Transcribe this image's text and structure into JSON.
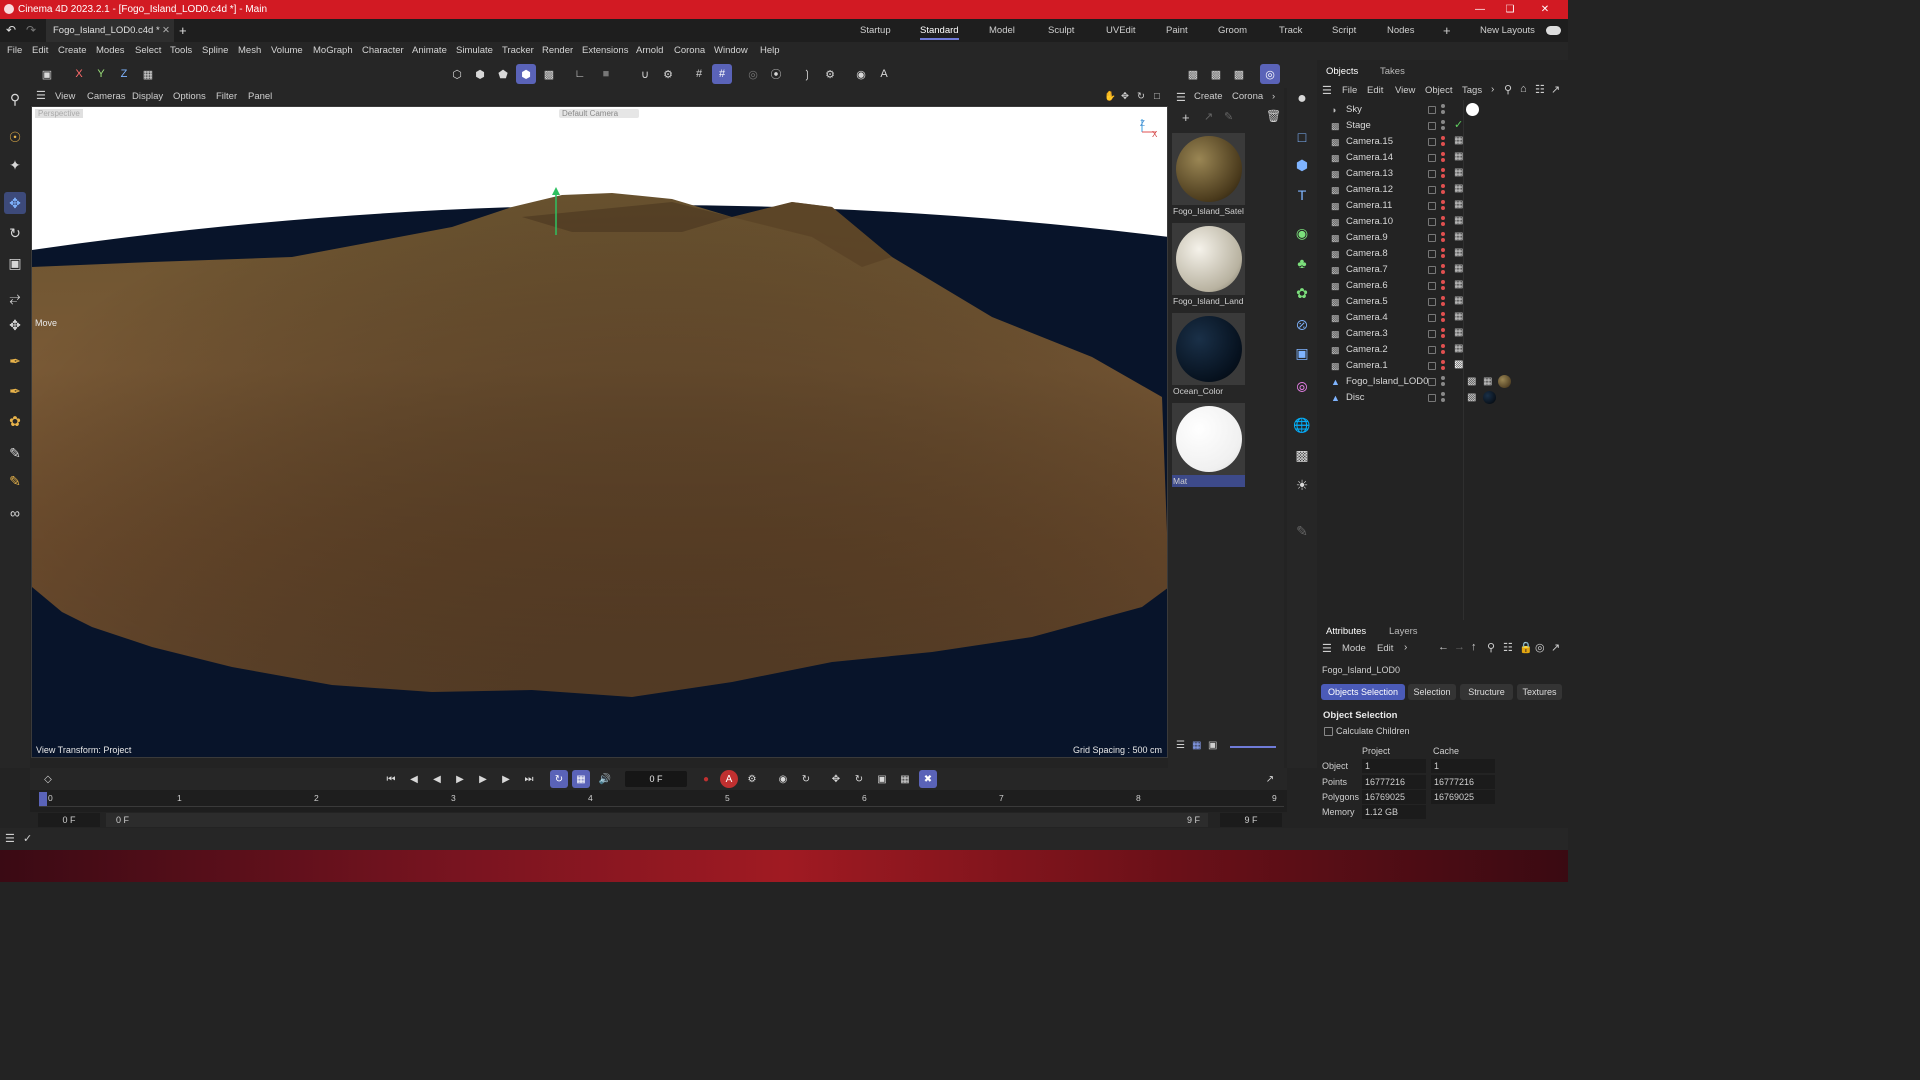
{
  "app_title": "Cinema 4D 2023.2.1 - [Fogo_Island_LOD0.c4d *] - Main",
  "document_tab": "Fogo_Island_LOD0.c4d *",
  "layouts": [
    "Startup",
    "Standard",
    "Model",
    "Sculpt",
    "UVEdit",
    "Paint",
    "Groom",
    "Track",
    "Script",
    "Nodes"
  ],
  "active_layout": "Standard",
  "new_layouts_label": "New Layouts",
  "menu": [
    "File",
    "Edit",
    "Create",
    "Modes",
    "Select",
    "Tools",
    "Spline",
    "Mesh",
    "Volume",
    "MoGraph",
    "Character",
    "Animate",
    "Simulate",
    "Tracker",
    "Render",
    "Extensions",
    "Arnold",
    "Corona",
    "Window",
    "Help"
  ],
  "axis_labels": {
    "x": "X",
    "y": "Y",
    "z": "Z"
  },
  "viewport": {
    "menu": [
      "View",
      "Cameras",
      "Display",
      "Options",
      "Filter",
      "Panel"
    ],
    "view_label": "Perspective",
    "camera_label": "Default Camera",
    "tool_label": "Move",
    "view_transform": "View Transform: Project",
    "grid_spacing": "Grid Spacing : 500 cm"
  },
  "material_manager": {
    "menu": [
      "Create",
      "Corona"
    ],
    "materials": [
      {
        "name": "Fogo_Island_Satel",
        "color": "#6b5a34"
      },
      {
        "name": "Fogo_Island_Land",
        "color": "#c9c3b3"
      },
      {
        "name": "Ocean_Color",
        "color": "#0a1a2e"
      },
      {
        "name": "Mat",
        "color": "#ffffff"
      }
    ]
  },
  "objects_panel": {
    "tabs": [
      "Objects",
      "Takes"
    ],
    "menu": [
      "File",
      "Edit",
      "View",
      "Object",
      "Tags"
    ],
    "objects": [
      {
        "name": "Sky",
        "icon": "sky"
      },
      {
        "name": "Stage",
        "icon": "stage"
      },
      {
        "name": "Camera.15",
        "icon": "camera"
      },
      {
        "name": "Camera.14",
        "icon": "camera"
      },
      {
        "name": "Camera.13",
        "icon": "camera"
      },
      {
        "name": "Camera.12",
        "icon": "camera"
      },
      {
        "name": "Camera.11",
        "icon": "camera"
      },
      {
        "name": "Camera.10",
        "icon": "camera"
      },
      {
        "name": "Camera.9",
        "icon": "camera"
      },
      {
        "name": "Camera.8",
        "icon": "camera"
      },
      {
        "name": "Camera.7",
        "icon": "camera"
      },
      {
        "name": "Camera.6",
        "icon": "camera"
      },
      {
        "name": "Camera.5",
        "icon": "camera"
      },
      {
        "name": "Camera.4",
        "icon": "camera"
      },
      {
        "name": "Camera.3",
        "icon": "camera"
      },
      {
        "name": "Camera.2",
        "icon": "camera"
      },
      {
        "name": "Camera.1",
        "icon": "camera"
      },
      {
        "name": "Fogo_Island_LOD0",
        "icon": "polygon"
      },
      {
        "name": "Disc",
        "icon": "polygon"
      }
    ]
  },
  "attributes_panel": {
    "tabs": [
      "Attributes",
      "Layers"
    ],
    "menu": [
      "Mode",
      "Edit"
    ],
    "object_name": "Fogo_Island_LOD0",
    "buttons": [
      "Objects Selection",
      "Selection",
      "Structure",
      "Textures"
    ],
    "section_title": "Object Selection",
    "calculate_children": "Calculate Children",
    "col_project": "Project",
    "col_cache": "Cache",
    "rows": [
      {
        "label": "Object",
        "project": "1",
        "cache": "1"
      },
      {
        "label": "Points",
        "project": "16777216",
        "cache": "16777216"
      },
      {
        "label": "Polygons",
        "project": "16769025",
        "cache": "16769025"
      },
      {
        "label": "Memory",
        "project": "1.12 GB",
        "cache": ""
      }
    ]
  },
  "timeline": {
    "current_frame": "0 F",
    "ticks": [
      "0",
      "1",
      "2",
      "3",
      "4",
      "5",
      "6",
      "7",
      "8",
      "9"
    ],
    "start_frame": "0 F",
    "min_frame": "0 F",
    "max_frame": "9 F",
    "end_frame": "9 F"
  }
}
